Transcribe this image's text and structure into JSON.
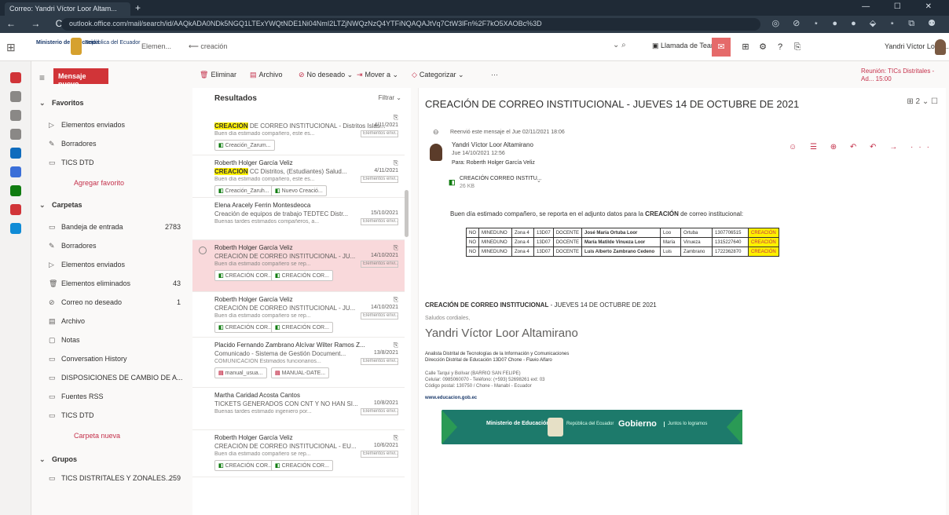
{
  "browser": {
    "tab_title": "Correo: Yandri Víctor Loor Altam...",
    "new_tab": "+",
    "nav": "← → C ⌂",
    "url": "outlook.office.com/mail/search/id/AAQkADA0NDk5NGQ1LTExYWQtNDE1Ni04NmI2LTZjNWQzNzQ4YTFiNQAQAJtVq7CtW3lFn%2F7kO5XAOBc%3D",
    "ext_icons": "◎ ⊘ ⋆ ● ● ⬙ ⋆ ⧉ ⚉",
    "window_controls": "— ☐ ✕"
  },
  "suite": {
    "ministry": "Ministerio de Educación",
    "gov": "República del Ecuador",
    "scope": "Elemen...",
    "search_value": "creación",
    "search_tools": "⌄ ⌕",
    "teams_call": "Llamada de Teams",
    "icons": [
      "⊞",
      "⚙",
      "?",
      "⎘"
    ],
    "account_name": "Yandri Víctor Loor ..."
  },
  "rail": {
    "colors": [
      "#d13438",
      "#8a8886",
      "#8a8886",
      "#8a8886",
      "#0f6cbd",
      "#3b6fd8",
      "#107c10",
      "#d13438",
      "#0f8bd6"
    ]
  },
  "folders": {
    "new_message": "Mensaje nuevo",
    "items": [
      {
        "icon": "⌄",
        "label": "Favoritos",
        "count": "",
        "type": "head"
      },
      {
        "icon": "▷",
        "label": "Elementos enviados",
        "count": "",
        "type": "indent"
      },
      {
        "icon": "✎",
        "label": "Borradores",
        "count": "",
        "type": "indent"
      },
      {
        "icon": "▭",
        "label": "TICS DTD",
        "count": "",
        "type": "indent"
      },
      {
        "icon": "",
        "label": "Agregar favorito",
        "count": "",
        "type": "link"
      },
      {
        "icon": "⌄",
        "label": "Carpetas",
        "count": "",
        "type": "head"
      },
      {
        "icon": "▭",
        "label": "Bandeja de entrada",
        "count": "2783",
        "type": "indent"
      },
      {
        "icon": "✎",
        "label": "Borradores",
        "count": "",
        "type": "indent"
      },
      {
        "icon": "▷",
        "label": "Elementos enviados",
        "count": "",
        "type": "indent"
      },
      {
        "icon": "🗑",
        "label": "Elementos eliminados",
        "count": "43",
        "type": "indent"
      },
      {
        "icon": "⊘",
        "label": "Correo no deseado",
        "count": "1",
        "type": "indent"
      },
      {
        "icon": "▤",
        "label": "Archivo",
        "count": "",
        "type": "indent"
      },
      {
        "icon": "▢",
        "label": "Notas",
        "count": "",
        "type": "indent"
      },
      {
        "icon": "▭",
        "label": "Conversation History",
        "count": "",
        "type": "indent"
      },
      {
        "icon": "▭",
        "label": "DISPOSICIONES DE CAMBIO DE A...",
        "count": "",
        "type": "indent"
      },
      {
        "icon": "▭",
        "label": "Fuentes RSS",
        "count": "",
        "type": "indent"
      },
      {
        "icon": "▭",
        "label": "TICS DTD",
        "count": "",
        "type": "indent"
      },
      {
        "icon": "",
        "label": "Carpeta nueva",
        "count": "",
        "type": "link"
      },
      {
        "icon": "⌄",
        "label": "Grupos",
        "count": "",
        "type": "head"
      },
      {
        "icon": "▭",
        "label": "TICS DISTRITALES Y ZONALES...",
        "count": "259",
        "type": "indent"
      }
    ]
  },
  "toolbar": {
    "items": [
      {
        "icon": "🗑",
        "label": "Eliminar"
      },
      {
        "icon": "▤",
        "label": "Archivo"
      },
      {
        "icon": "⊘",
        "label": "No deseado ⌄"
      },
      {
        "icon": "⇥",
        "label": "Mover a ⌄"
      },
      {
        "icon": "◇",
        "label": "Categorizar ⌄"
      },
      {
        "icon": "",
        "label": "···"
      }
    ],
    "schedule": "Reunión: TICs Distritales - Ad... 15:00"
  },
  "list": {
    "title": "Resultados",
    "filter": "Filtrar ⌄",
    "messages": [
      {
        "sender": "",
        "subject_hl": "CREACIÓN",
        "subject": " DE CORREO INSTITUCIONAL - Distritos Islas...",
        "date": "4/11/2021",
        "preview": "Buen día estimado compañero, este es...",
        "tag": "Elementos envi...",
        "chips": [
          {
            "ic": "◧",
            "label": "Creación_Zarum..."
          }
        ],
        "selected": false
      },
      {
        "sender": "Roberth Holger García Veliz",
        "subject_hl": "CREACIÓN",
        "subject": " CC Distritos, (Estudiantes) Salud...",
        "date": "4/11/2021",
        "preview": "Buen día estimado compañero, este es...",
        "tag": "Elementos envi...",
        "chips": [
          {
            "ic": "◧",
            "label": "Creación_Zaruh..."
          },
          {
            "ic": "◧",
            "label": "Nuevo Creació..."
          }
        ],
        "selected": false
      },
      {
        "sender": "Elena Aracely Ferrin Montesdeoca",
        "subject_hl": "",
        "subject": "Creación de equipos de trabajo TEDTEC Distr...",
        "date": "15/10/2021",
        "preview": "Buenas tardes estimados compañeros, a...",
        "tag": "Elementos envi...",
        "chips": [],
        "selected": false
      },
      {
        "sender": "Roberth Holger García Veliz",
        "subject_hl": "",
        "subject": "CREACIÓN DE CORREO INSTITUCIONAL - JU...",
        "date": "14/10/2021",
        "preview": "Buen día estimado compañero se rep...",
        "tag": "Elementos envi...",
        "chips": [
          {
            "ic": "◧",
            "label": "CREACIÓN COR..."
          },
          {
            "ic": "◧",
            "label": "CREACIÓN COR..."
          }
        ],
        "selected": true
      },
      {
        "sender": "Roberth Holger García Veliz",
        "subject_hl": "",
        "subject": "CREACIÓN DE CORREO INSTITUCIONAL - JU...",
        "date": "14/10/2021",
        "preview": "Buen día estimado compañero se rep...",
        "tag": "Elementos envi...",
        "chips": [
          {
            "ic": "◧",
            "label": "CREACIÓN COR..."
          },
          {
            "ic": "◧",
            "label": "CREACIÓN COR..."
          }
        ],
        "selected": false
      },
      {
        "sender": "Placido Fernando Zambrano Alcívar Wilter Ramos Z...",
        "subject_hl": "",
        "subject": "Comunicado - Sistema de Gestión Document...",
        "date": "13/8/2021",
        "preview": "COMUNICACIÓN Estimados funcionarios...",
        "tag": "Elementos envi...",
        "chips": [
          {
            "ic": "▤",
            "label": "manual_usua..."
          },
          {
            "ic": "▤",
            "label": "MANUAL-DATE..."
          }
        ],
        "selected": false
      },
      {
        "sender": "Martha Caridad Acosta Cantos",
        "subject_hl": "",
        "subject": "TICKETS GENERADOS CON CNT Y NO HAN SI...",
        "date": "10/8/2021",
        "preview": "Buenas tardes estimado ingeniero por...",
        "tag": "Elementos envi...",
        "chips": [],
        "selected": false
      },
      {
        "sender": "Roberth Holger García Veliz",
        "subject_hl": "",
        "subject": "CREACIÓN DE CORREO INSTITUCIONAL - EU...",
        "date": "10/6/2021",
        "preview": "Buen día estimado compañero se rep...",
        "tag": "Elementos envi...",
        "chips": [
          {
            "ic": "◧",
            "label": "CREACIÓN COR..."
          },
          {
            "ic": "◧",
            "label": "CREACIÓN COR..."
          }
        ],
        "selected": false
      }
    ]
  },
  "reading": {
    "subject": "CREACIÓN DE CORREO INSTITUCIONAL - JUEVES 14 DE OCTUBRE DE 2021",
    "subject_tools": "⊞ 2 ⌄ ☐",
    "info": "Reenvió este mensaje el Jue 02/11/2021 18:06",
    "from": "Yandri Víctor Loor Altamirano",
    "date": "Jue 14/10/2021 12:56",
    "to": "Para: Roberth Holger García Veliz",
    "actions": "☺ ☰ ⊕ ↶ ↶ → ···",
    "attachment_name": "CREACIÓN CORREO INSTITU...",
    "attachment_size": "26 KB",
    "body_pre": "Buen día estimado compañero, se reporta en el adjunto datos para la ",
    "body_bold": "CREACIÓN",
    "body_post": " de correo institucional:",
    "table": [
      [
        "NO",
        "MINEDUNO",
        "Zona 4",
        "13D07",
        "DOCENTE",
        "José María Ortuba Loor",
        "Loo",
        "Ortuba",
        "1307706515",
        "CREACIÓN"
      ],
      [
        "NO",
        "MINEDUNO",
        "Zona 4",
        "13D07",
        "DOCENTE",
        "María Matilde Vinueza Loor",
        "María",
        "Vinueza",
        "1315227640",
        "CREACIÓN"
      ],
      [
        "NO",
        "MINEDUNO",
        "Zona 4",
        "13D07",
        "DOCENTE",
        "Luis Alberto Zambrano Cedeno",
        "Luis",
        "Zambrano",
        "1722362870",
        "CREACIÓN"
      ]
    ],
    "sig_title_bold": "CREACIÓN DE CORREO INSTITUCIONAL",
    "sig_title_rest": " - JUEVES 14 DE OCTUBRE DE 2021",
    "sig_regards": "Saludos cordiales,",
    "sig_name": "Yandri Víctor Loor Altamirano",
    "sig_role1": "Analista Distrital de Tecnologías de la Información y Comunicaciones",
    "sig_role2": "Dirección Distrital de Educación 13D07 Chone - Flavio Alfaro",
    "sig_contact1": "Calle Tarqui y Bolívar (BARRIO SAN FELIPE)",
    "sig_contact2": "Celular: 0985060070 - Teléfono: (+593) 52698261 ext: 03",
    "sig_contact3": "Código postal: 130750 / Chone - Manabí - Ecuador",
    "sig_web": "www.educacion.gob.ec",
    "banner_ministry": "Ministerio de Educación",
    "banner_gov": "República del Ecuador",
    "banner_gobierno": "Gobierno",
    "banner_tag": "Juntos lo logramos"
  }
}
